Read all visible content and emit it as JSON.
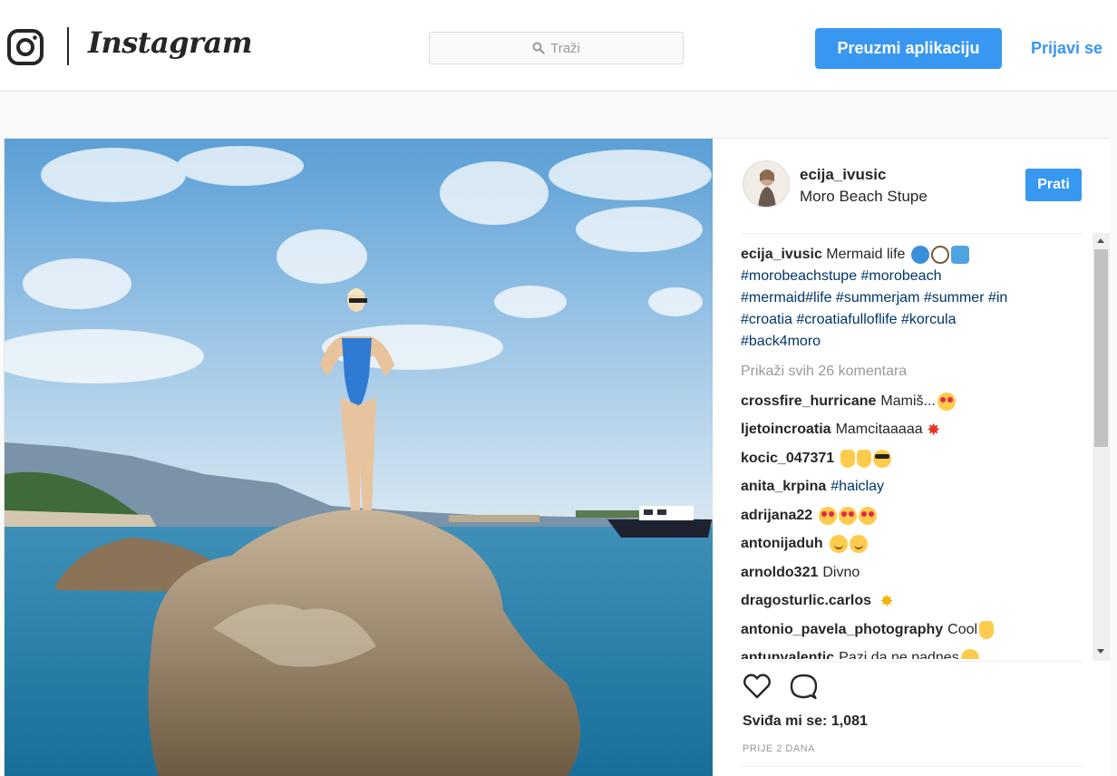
{
  "header": {
    "brand": "Instagram",
    "search_placeholder": "Traži",
    "download_label": "Preuzmi aplikaciju",
    "login_label": "Prijavi se",
    "accent_color": "#3897f0"
  },
  "post": {
    "username": "ecija_ivusic",
    "location": "Moro Beach Stupe",
    "follow_label": "Prati",
    "caption_username": "ecija_ivusic",
    "caption_text": "Mermaid life",
    "caption_emoji": [
      "wave-emoji",
      "shell-emoji",
      "mermaid-emoji"
    ],
    "hashtags_line1": "#morobeachstupe #morobeach",
    "hashtags_line2": "#mermaid#life #summerjam #summer #in",
    "hashtags_line3": "#croatia #croatiafulloflife #korcula",
    "hashtags_line4": "#back4moro",
    "view_all_comments": "Prikaži svih 26 komentara",
    "comments": [
      {
        "user": "crossfire_hurricane",
        "text": "Mamiš...",
        "emoji": [
          "heart-eyes"
        ]
      },
      {
        "user": "ljetoincroatia",
        "text": "Mamcitaaaaa",
        "emoji": [
          "burst"
        ]
      },
      {
        "user": "kocic_047371",
        "text": "",
        "emoji": [
          "thumbs-up",
          "clap",
          "cool"
        ]
      },
      {
        "user": "anita_krpina",
        "text": "#haiclay",
        "emoji": []
      },
      {
        "user": "adrijana22",
        "text": "",
        "emoji": [
          "heart-eyes",
          "heart-eyes",
          "heart-eyes"
        ]
      },
      {
        "user": "antonijaduh",
        "text": "",
        "emoji": [
          "smile",
          "smile"
        ]
      },
      {
        "user": "arnoldo321",
        "text": "Divno",
        "emoji": []
      },
      {
        "user": "dragosturlic.carlos",
        "text": "",
        "emoji": [
          "sparkle"
        ]
      },
      {
        "user": "antonio_pavela_photography",
        "text": "Cool",
        "emoji": [
          "ok-hand"
        ]
      },
      {
        "user": "antunvalentic",
        "text": "Pazi da ne padnes",
        "emoji": [
          "smile"
        ]
      }
    ],
    "likes_label": "Sviđa mi se: 1,081",
    "timestamp": "PRIJE 2 DANA"
  }
}
